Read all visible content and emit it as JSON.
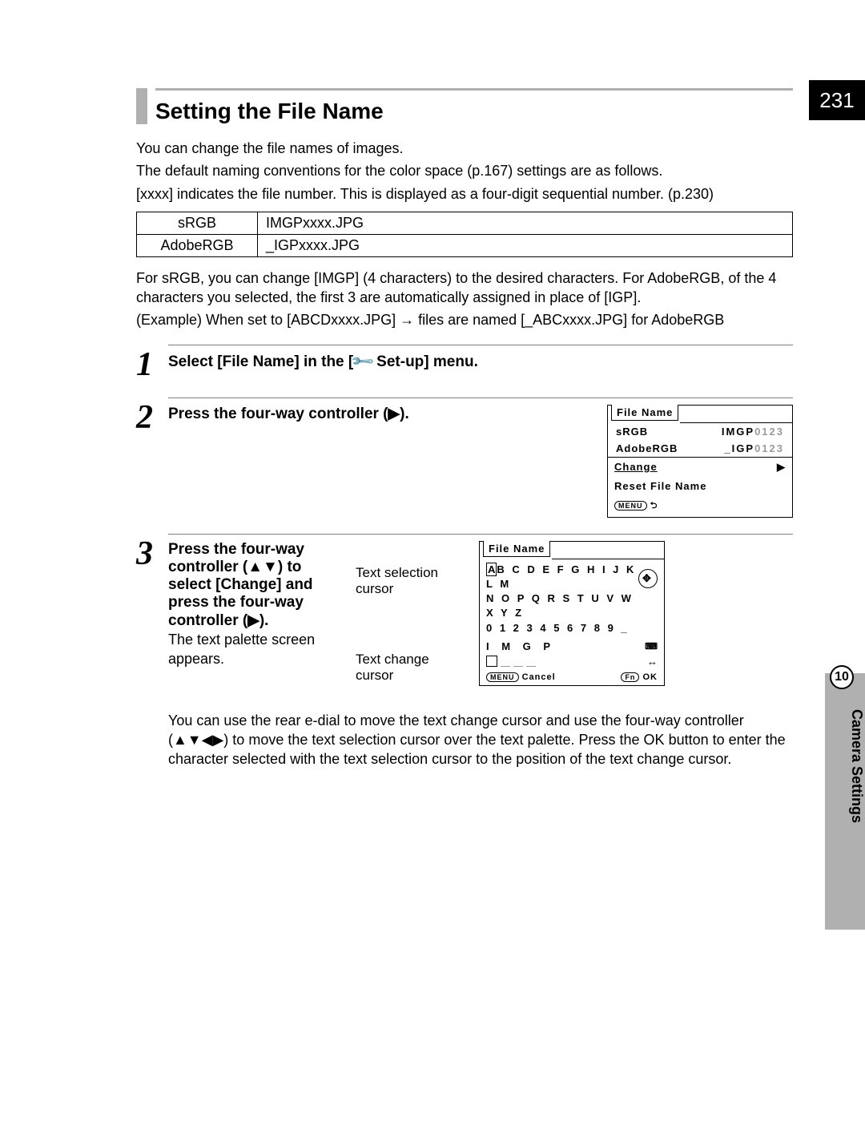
{
  "page_num": "231",
  "side_chapter": "10",
  "side_label": "Camera Settings",
  "section_title": "Setting the File Name",
  "intro": {
    "p1": "You can change the file names of images.",
    "p2": "The default naming conventions for the color space (p.167) settings are as follows.",
    "p3": "[xxxx] indicates the file number. This is displayed as a four-digit sequential number. (p.230)"
  },
  "fn_table": {
    "r1c1": "sRGB",
    "r1c2": "IMGPxxxx.JPG",
    "r2c1": "AdobeRGB",
    "r2c2": "_IGPxxxx.JPG"
  },
  "after_table": {
    "p1": "For sRGB, you can change [IMGP] (4 characters) to the desired characters. For AdobeRGB, of the 4 characters you selected, the first 3 are automatically assigned in place of [IGP].",
    "p2": "(Example) When set to [ABCDxxxx.JPG] → files are named [_ABCxxxx.JPG] for AdobeRGB"
  },
  "step1": {
    "num": "1",
    "title_pre": "Select [File Name] in the [",
    "title_post": " Set-up] menu."
  },
  "step2": {
    "num": "2",
    "title": "Press the four-way controller (▶).",
    "screen": {
      "title": "File Name",
      "row1_label": "sRGB",
      "row1_val_bold": "IMGP",
      "row1_val_fade": "0123",
      "row2_label": "AdobeRGB",
      "row2_val_pre": "_",
      "row2_val_bold": "IGP",
      "row2_val_fade": "0123",
      "item1": "Change",
      "item2": "Reset File Name",
      "footer_menu": "MENU",
      "footer_back": "⮌"
    }
  },
  "step3": {
    "num": "3",
    "title": "Press the four-way controller (▲▼) to select [Change] and press the four-way controller (▶).",
    "desc": "The text palette screen appears.",
    "labels": {
      "sel": "Text selection cursor",
      "chg": "Text change cursor"
    },
    "screen": {
      "title": "File Name",
      "line1_first": "A",
      "line1_rest": "B C D E F G H I J K L M",
      "line2": "N O P Q R S T U V W X Y Z",
      "line3": "0 1 2 3 4 5 6 7 8 9 _",
      "entry": "I M G P",
      "footer_menu": "MENU",
      "footer_cancel": "Cancel",
      "footer_fn": "Fn",
      "footer_ok": "OK"
    },
    "note": "You can use the rear e-dial to move the text change cursor and use the four-way controller (▲▼◀▶) to move the text selection cursor over the text palette. Press the OK button to enter the character selected with the text selection cursor to the position of the text change cursor."
  }
}
